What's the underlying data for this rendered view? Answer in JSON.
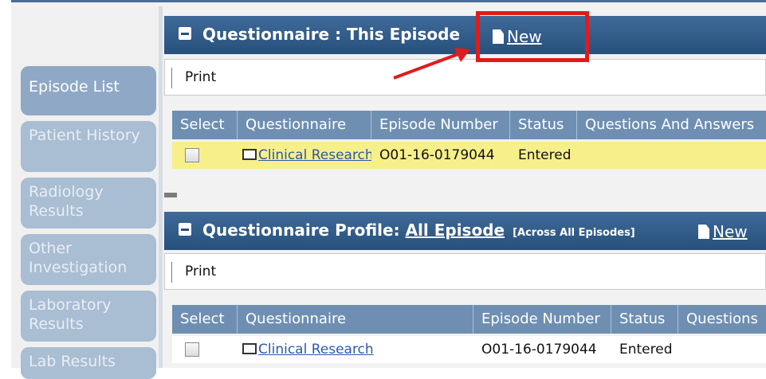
{
  "colors": {
    "header": "#2f5b8a",
    "table_header": "#6f8fb2",
    "selected_row": "#f7ef8a",
    "callout": "#e11b1b",
    "link": "#2a5aa8"
  },
  "sidebar": {
    "items": [
      {
        "label": "Episode List",
        "active": true
      },
      {
        "label": "Patient History",
        "active": false
      },
      {
        "label": "Radiology Results",
        "active": false
      },
      {
        "label": "Other Investigation",
        "active": false
      },
      {
        "label": "Laboratory Results",
        "active": false
      },
      {
        "label": "Lab Results",
        "active": false
      }
    ]
  },
  "section1": {
    "title": "Questionnaire : This Episode",
    "new_label": "New",
    "print_label": "Print",
    "columns": [
      "Select",
      "Questionnaire",
      "Episode Number",
      "Status",
      "Questions And Answers"
    ],
    "rows": [
      {
        "questionnaire": "Clinical Research",
        "episode_number": "O01-16-0179044",
        "status": "Entered",
        "questions_and_answers": ""
      }
    ]
  },
  "section2": {
    "title_prefix": "Questionnaire Profile:",
    "title_link": "All Episode",
    "title_note": "[Across All Episodes]",
    "new_label": "New",
    "print_label": "Print",
    "columns": [
      "Select",
      "Questionnaire",
      "Episode Number",
      "Status",
      "Questions"
    ],
    "rows": [
      {
        "questionnaire": "Clinical Research",
        "episode_number": "O01-16-0179044",
        "status": "Entered",
        "questions": ""
      }
    ]
  },
  "annotation": {
    "callout_target": "new-link",
    "arrow": "red-arrow-icon"
  }
}
